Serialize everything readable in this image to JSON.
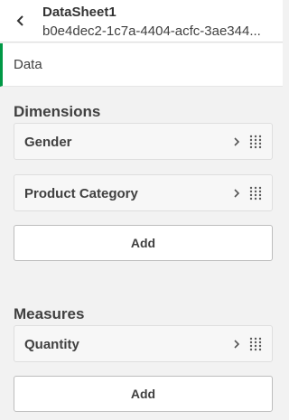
{
  "header": {
    "title": "DataSheet1",
    "subtitle": "b0e4dec2-1c7a-4404-acfc-3ae344..."
  },
  "tab": {
    "label": "Data"
  },
  "dimensions": {
    "title": "Dimensions",
    "items": [
      {
        "label": "Gender"
      },
      {
        "label": "Product Category"
      }
    ],
    "add_label": "Add"
  },
  "measures": {
    "title": "Measures",
    "items": [
      {
        "label": "Quantity"
      }
    ],
    "add_label": "Add"
  },
  "colors": {
    "accent": "#009845",
    "background": "#f2f2f2"
  },
  "icons": [
    "chevron-left-icon",
    "chevron-right-icon",
    "drag-handle-icon"
  ]
}
